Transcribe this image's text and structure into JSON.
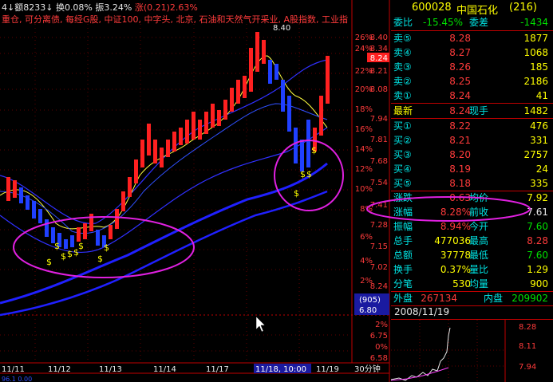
{
  "topbar": {
    "vol_text": "4↓额8233↓",
    "turnover_label": "换",
    "turnover": "0.08%",
    "amp_label": "振",
    "amp": "3.24%",
    "chg_label": "涨",
    "chg": "(0.21)2.63%",
    "tags": "重仓, 可分离债, 每经G股, 中证100, 中字头, 北京, 石油和天然气开采业, A股指数, 工业指"
  },
  "price_axis": {
    "labels": [
      "8.40",
      "8.34",
      "8.24",
      "8.21",
      "8.08",
      "7.94",
      "7.81",
      "7.68",
      "7.54",
      "7.41",
      "7.28",
      "7.15",
      "7.02"
    ],
    "pct_labels": [
      "26%",
      "24%",
      "22%",
      "20%",
      "18%",
      "16%",
      "14%",
      "12%",
      "10%",
      "8%",
      "6%",
      "4%",
      "2%"
    ],
    "current": "8.24",
    "peak_label": "8.40"
  },
  "vol_axis": {
    "box_label": "(905)",
    "box_value": "6.80",
    "labels": [
      "6.75",
      "6.58"
    ],
    "pct": [
      "2%",
      "0%"
    ]
  },
  "x_axis": {
    "dates": [
      "11/11",
      "11/12",
      "11/13",
      "11/14",
      "11/17",
      "11/18, 10:00",
      "11/19"
    ],
    "period": "30分钟",
    "bottom_text": "96.1 0.00"
  },
  "quote": {
    "code": "600028",
    "name": "中国石化",
    "count": "(216)",
    "ratio_label": "委比",
    "ratio": "-15.45%",
    "diff_label": "委差",
    "diff": "-1434",
    "sells": [
      {
        "label": "卖⑤",
        "price": "8.28",
        "vol": "1877"
      },
      {
        "label": "卖④",
        "price": "8.27",
        "vol": "1068"
      },
      {
        "label": "卖③",
        "price": "8.26",
        "vol": "185"
      },
      {
        "label": "卖②",
        "price": "8.25",
        "vol": "2186"
      },
      {
        "label": "卖①",
        "price": "8.24",
        "vol": "41"
      }
    ],
    "latest_label": "最新",
    "latest": "8.24",
    "now_hand_label": "现手",
    "now_hand": "1482",
    "buys": [
      {
        "label": "买①",
        "price": "8.22",
        "vol": "476"
      },
      {
        "label": "买②",
        "price": "8.21",
        "vol": "331"
      },
      {
        "label": "买③",
        "price": "8.20",
        "vol": "2757"
      },
      {
        "label": "买④",
        "price": "8.19",
        "vol": "24"
      },
      {
        "label": "买⑤",
        "price": "8.18",
        "vol": "335"
      }
    ],
    "stats": [
      {
        "l1": "涨跌",
        "v1": "0.63",
        "l2": "均价",
        "v2": "7.92"
      },
      {
        "l1": "涨幅",
        "v1": "8.28%",
        "l2": "前收",
        "v2": "7.61"
      },
      {
        "l1": "振幅",
        "v1": "8.94%",
        "l2": "今开",
        "v2": "7.60"
      },
      {
        "l1": "总手",
        "v1": "477036",
        "l2": "最高",
        "v2": "8.28"
      },
      {
        "l1": "总额",
        "v1": "37778",
        "l2": "最低",
        "v2": "7.60"
      },
      {
        "l1": "换手",
        "v1": "0.37%",
        "l2": "量比",
        "v2": "1.29"
      },
      {
        "l1": "分笔",
        "v1": "530",
        "l2": "均量",
        "v2": "900"
      }
    ],
    "outer_label": "外盘",
    "outer": "267134",
    "inner_label": "内盘",
    "inner": "209902",
    "date": "2008/11/19",
    "mini_labels": [
      "8.28",
      "8.11",
      "7.94"
    ]
  },
  "colors": {
    "up": "#ff2020",
    "down": "#2040ff",
    "ma_yellow": "#ffff00",
    "ma_blue": "#2020ff",
    "annot": "#e020e0",
    "axis": "#c00000"
  }
}
